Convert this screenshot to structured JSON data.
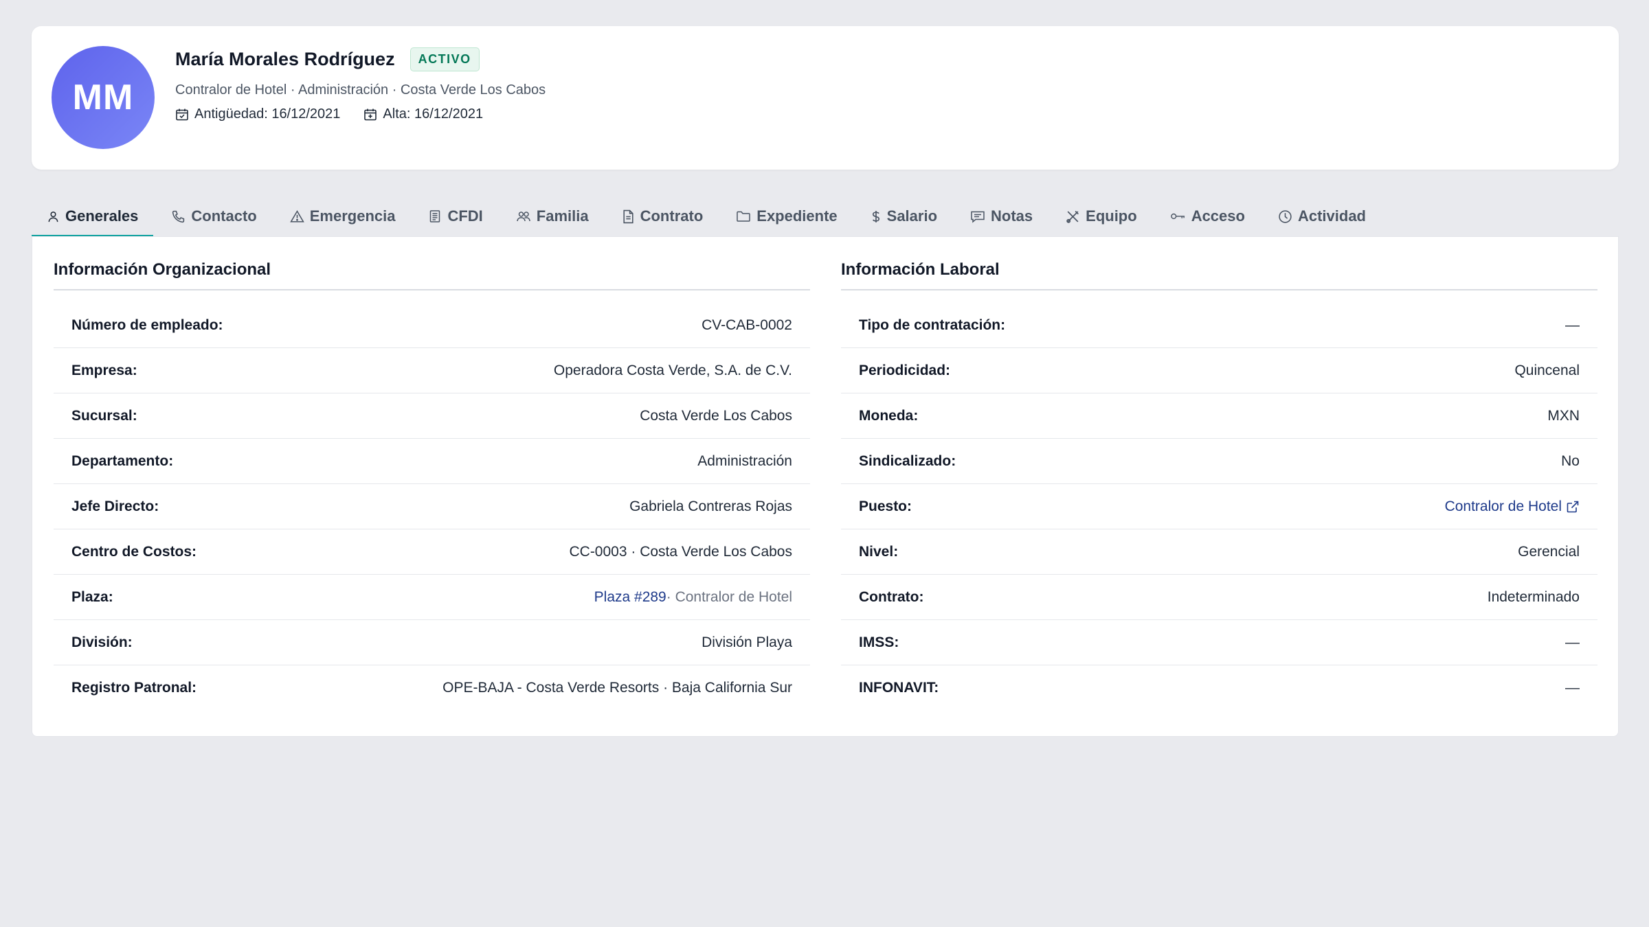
{
  "employee": {
    "initials": "MM",
    "name": "María Morales Rodríguez",
    "status": "ACTIVO",
    "subtitle": "Contralor de Hotel · Administración · Costa Verde Los Cabos",
    "seniority_label": "Antigüedad: 16/12/2021",
    "hire_label": "Alta: 16/12/2021"
  },
  "tabs": [
    {
      "label": "Generales",
      "icon": "user-icon",
      "active": true
    },
    {
      "label": "Contacto",
      "icon": "phone-icon"
    },
    {
      "label": "Emergencia",
      "icon": "warning-icon"
    },
    {
      "label": "CFDI",
      "icon": "receipt-icon"
    },
    {
      "label": "Familia",
      "icon": "users-icon"
    },
    {
      "label": "Contrato",
      "icon": "document-icon"
    },
    {
      "label": "Expediente",
      "icon": "folder-icon"
    },
    {
      "label": "Salario",
      "icon": "dollar-icon"
    },
    {
      "label": "Notas",
      "icon": "message-icon"
    },
    {
      "label": "Equipo",
      "icon": "tools-icon"
    },
    {
      "label": "Acceso",
      "icon": "key-icon"
    },
    {
      "label": "Actividad",
      "icon": "clock-icon"
    }
  ],
  "org": {
    "title": "Información Organizacional",
    "rows": [
      {
        "label": "Número de empleado:",
        "value": "CV-CAB-0002"
      },
      {
        "label": "Empresa:",
        "value": "Operadora Costa Verde, S.A. de C.V."
      },
      {
        "label": "Sucursal:",
        "value": "Costa Verde Los Cabos"
      },
      {
        "label": "Departamento:",
        "value": "Administración"
      },
      {
        "label": "Jefe Directo:",
        "value": "Gabriela Contreras Rojas"
      },
      {
        "label": "Centro de Costos:",
        "value": "CC-0003 · Costa Verde Los Cabos"
      },
      {
        "label": "Plaza:",
        "link": "Plaza #289",
        "suffix": " · Contralor de Hotel"
      },
      {
        "label": "División:",
        "value": "División Playa"
      },
      {
        "label": "Registro Patronal:",
        "value": "OPE-BAJA - Costa Verde Resorts · Baja California Sur"
      }
    ]
  },
  "work": {
    "title": "Información Laboral",
    "rows": [
      {
        "label": "Tipo de contratación:",
        "value": "—"
      },
      {
        "label": "Periodicidad:",
        "value": "Quincenal"
      },
      {
        "label": "Moneda:",
        "value": "MXN"
      },
      {
        "label": "Sindicalizado:",
        "value": "No"
      },
      {
        "label": "Puesto:",
        "link": "Contralor de Hotel"
      },
      {
        "label": "Nivel:",
        "value": "Gerencial"
      },
      {
        "label": "Contrato:",
        "value": "Indeterminado"
      },
      {
        "label": "IMSS:",
        "value": "—"
      },
      {
        "label": "INFONAVIT:",
        "value": "—"
      }
    ]
  },
  "colors": {
    "accent": "#14a3a1",
    "avatar": "#6b72f0",
    "status_green": "#047857",
    "link": "#1e3a8a"
  }
}
